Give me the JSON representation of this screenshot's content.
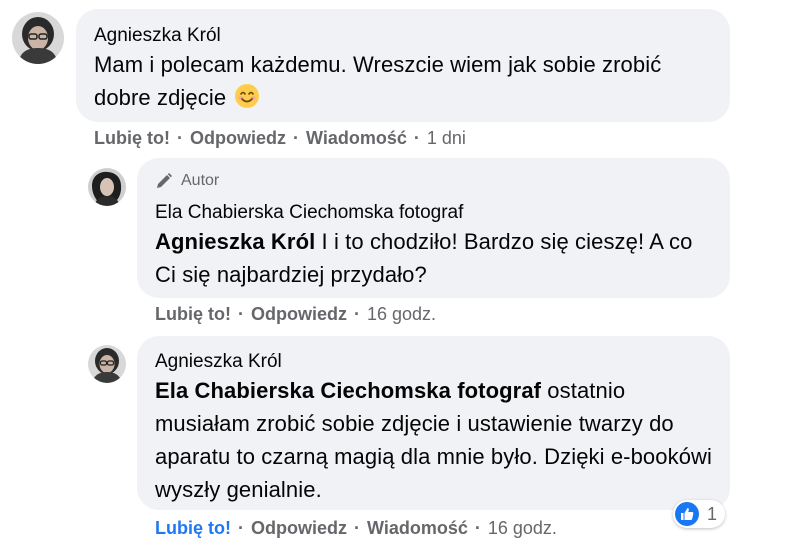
{
  "comments": [
    {
      "author": "Agnieszka Król",
      "text": "Mam i polecam każdemu. Wreszcie wiem jak sobie zrobić dobre zdjęcie",
      "emoji": "smiling-face-emoji",
      "actions": {
        "like": "Lubię to!",
        "reply": "Odpowiedz",
        "message": "Wiadomość",
        "time": "1 dni"
      }
    },
    {
      "badge": "Autor",
      "author": "Ela Chabierska Ciechomska fotograf",
      "mention": "Agnieszka Król",
      "text": " I i to chodziło! Bardzo się cieszę! A co Ci się najbardziej przydało?",
      "actions": {
        "like": "Lubię to!",
        "reply": "Odpowiedz",
        "time": "16 godz."
      }
    },
    {
      "author": "Agnieszka Król",
      "mention": "Ela Chabierska Ciechomska fotograf",
      "text": " ostatnio musiałam zrobić sobie zdjęcie i ustawienie twarzy do aparatu to czarną magią dla mnie było. Dzięki e-bookówi wyszły genialnie.",
      "actions": {
        "like": "Lubię to!",
        "reply": "Odpowiedz",
        "message": "Wiadomość",
        "time": "16 godz."
      },
      "liked": true,
      "reaction_count": "1"
    }
  ],
  "colors": {
    "bubble": "#f0f2f5",
    "meta": "#65676b",
    "like_active": "#2078f4"
  }
}
